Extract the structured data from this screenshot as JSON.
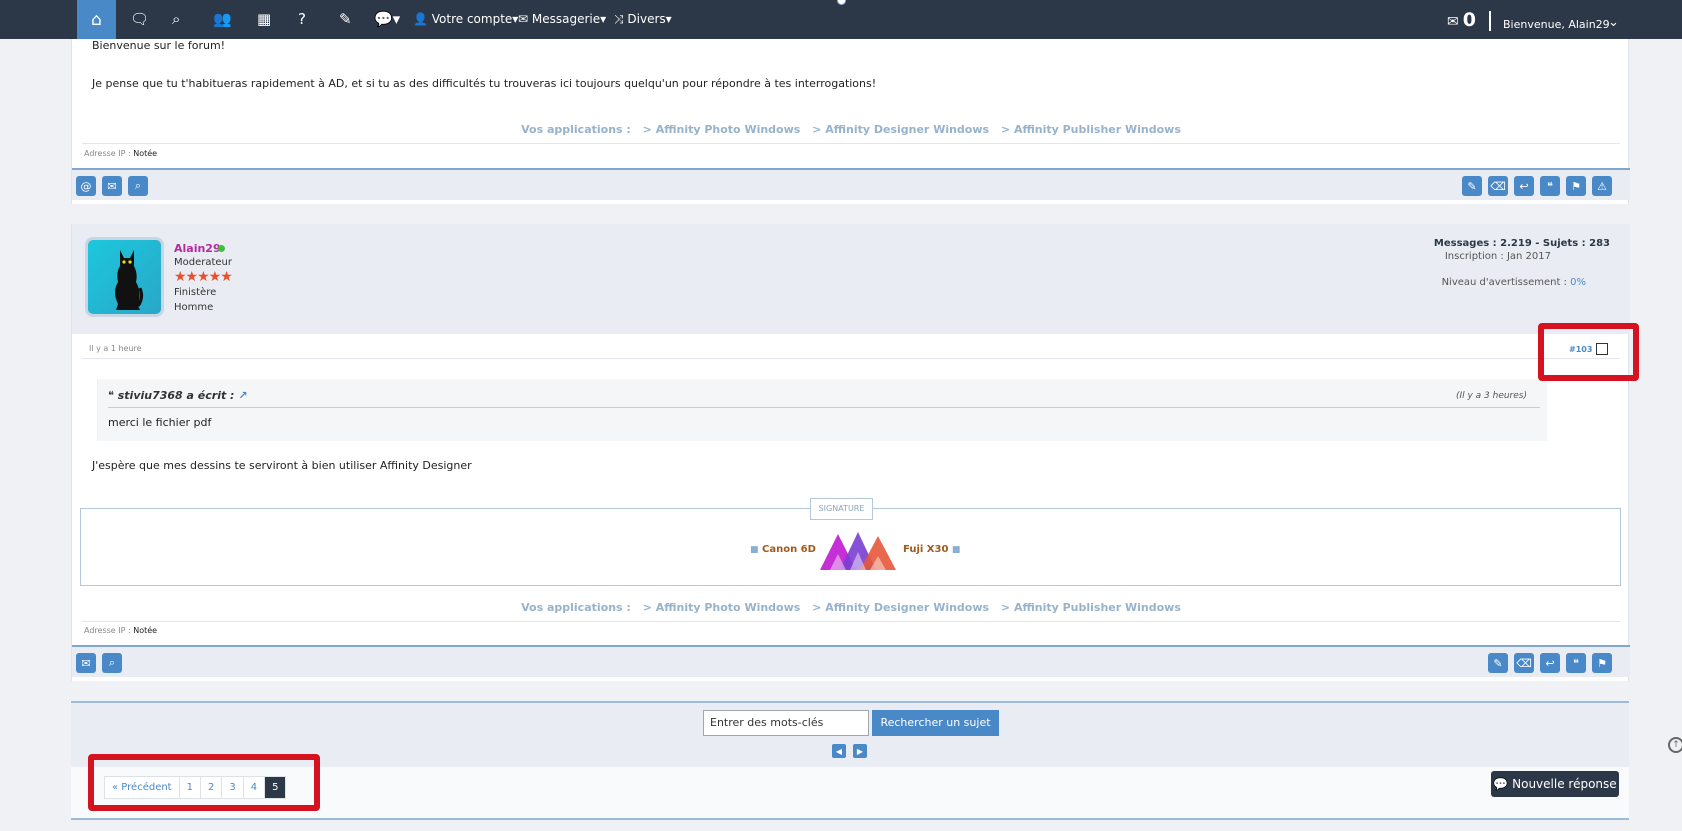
{
  "nav": {
    "home_icon": "home-icon",
    "account_label": "Votre compte",
    "mail_label": "Messagerie",
    "misc_label": "Divers",
    "mail_count": "0",
    "welcome": "Bienvenue, Alain29"
  },
  "post_prev": {
    "line1": "Bienvenue sur le forum!",
    "line2": "Je pense que tu t'habitueras rapidement à AD, et si tu as des difficultés tu trouveras ici toujours quelqu'un pour répondre à tes interrogations!",
    "applinks_label": "Vos applications :",
    "app1": "> Affinity Photo Windows",
    "app2": "> Affinity Designer Windows",
    "app3": "> Affinity Publisher Windows",
    "ip_label": "Adresse IP :",
    "ip_value": "Notée"
  },
  "post": {
    "username": "Alain29",
    "role": "Moderateur",
    "stars": "★★★★★",
    "region": "Finistère",
    "gender": "Homme",
    "messages": "Messages : 2.219 - Sujets : 283",
    "inscription": "Inscription : Jan 2017",
    "warning_label": "Niveau d'avertissement :",
    "warning_value": "0%",
    "time": "Il y a 1 heure",
    "number": "#103",
    "quote_author": "stiviu7368 a écrit :",
    "quote_time": "(Il y a 3 heures)",
    "quote_text": "merci le fichier pdf",
    "body": "J'espère que mes dessins te serviront à bien utiliser Affinity Designer",
    "signature_label": "SIGNATURE",
    "sig_left": "Canon 6D",
    "sig_right": "Fuji X30",
    "applinks_label": "Vos applications :",
    "app1": "> Affinity Photo Windows",
    "app2": "> Affinity Designer Windows",
    "app3": "> Affinity Publisher Windows",
    "ip_label": "Adresse IP :",
    "ip_value": "Notée"
  },
  "search": {
    "placeholder": "Entrer des mots-clés",
    "button": "Rechercher un sujet"
  },
  "pagination": {
    "prev": "« Précédent",
    "pages": [
      "1",
      "2",
      "3",
      "4",
      "5"
    ],
    "active": "5"
  },
  "new_reply": "Nouvelle réponse",
  "colors": {
    "topbar": "#2c3848",
    "accent": "#4a89c8",
    "highlight": "#d51320"
  }
}
